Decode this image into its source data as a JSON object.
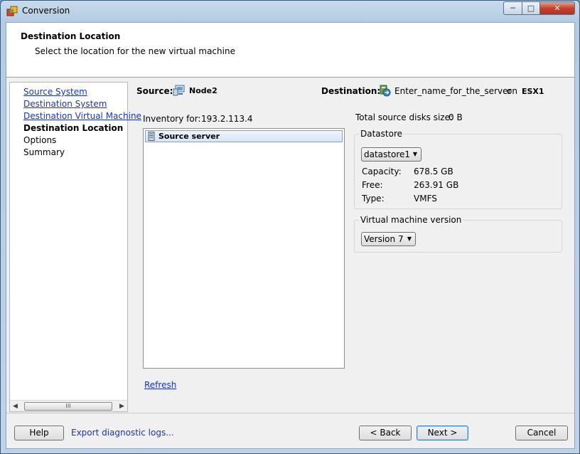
{
  "window": {
    "title": "Conversion"
  },
  "header": {
    "title": "Destination Location",
    "subtitle": "Select the location for the new virtual machine"
  },
  "nav": {
    "items": [
      {
        "label": "Source System",
        "state": "link"
      },
      {
        "label": "Destination System",
        "state": "link"
      },
      {
        "label": "Destination Virtual Machine",
        "state": "link"
      },
      {
        "label": "Destination Location",
        "state": "current"
      },
      {
        "label": "Options",
        "state": "plain"
      },
      {
        "label": "Summary",
        "state": "plain"
      }
    ],
    "scroll_grip": "III"
  },
  "source": {
    "label": "Source:",
    "name": "Node2",
    "icon": "computer-icon"
  },
  "destination": {
    "label": "Destination:",
    "name": "Enter_name_for_the_server",
    "on_text": "on",
    "host": "ESX1",
    "icon": "server-convert-icon"
  },
  "inventory": {
    "label": "Inventory for:",
    "host": "193.2.113.4",
    "tree_items": [
      {
        "label": "Source server",
        "icon": "server-icon",
        "selected": true
      }
    ],
    "refresh_label": "Refresh"
  },
  "disks": {
    "label": "Total source disks size:",
    "value": "0 B"
  },
  "datastore": {
    "group_title": "Datastore",
    "selected": "datastore1",
    "capacity_label": "Capacity:",
    "capacity": "678.5 GB",
    "free_label": "Free:",
    "free": "263.91 GB",
    "type_label": "Type:",
    "type": "VMFS"
  },
  "vm_version": {
    "group_title": "Virtual machine version",
    "selected": "Version 7"
  },
  "footer": {
    "help": "Help",
    "export_logs": "Export diagnostic logs...",
    "back": "< Back",
    "next": "Next >",
    "cancel": "Cancel"
  },
  "colors": {
    "link": "#1a33c4",
    "title_close": "#c7412a"
  }
}
